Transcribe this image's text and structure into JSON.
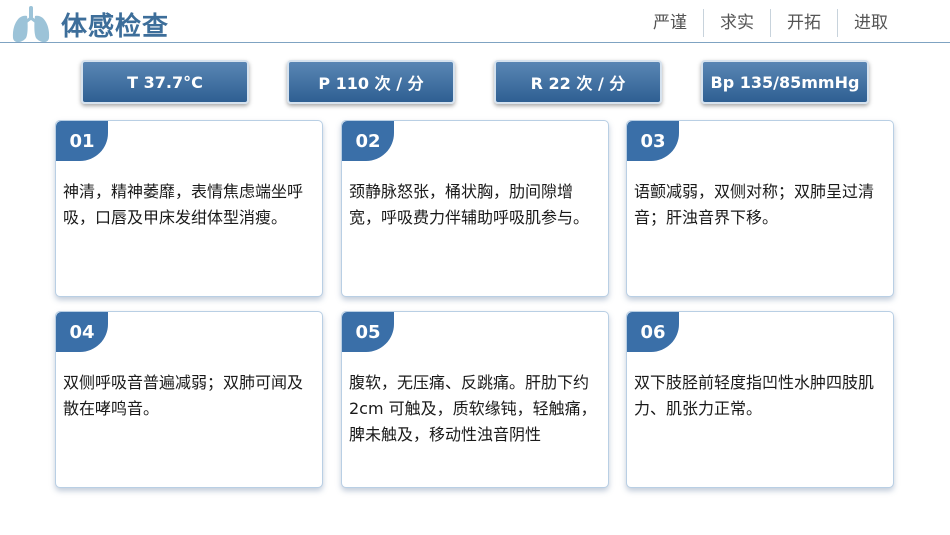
{
  "header": {
    "title": "体感检查",
    "nav": [
      "严谨",
      "求实",
      "开拓",
      "进取"
    ]
  },
  "vitals": [
    "T 37.7°C",
    "P 110 次 / 分",
    "R 22 次 / 分",
    "Bp 135/85mmHg"
  ],
  "cards": [
    {
      "num": "01",
      "text": "神清，精神萎靡，表情焦虑端坐呼吸，口唇及甲床发绀体型消瘦。"
    },
    {
      "num": "02",
      "text": "颈静脉怒张，桶状胸，肋间隙增宽，呼吸费力伴辅助呼吸肌参与。"
    },
    {
      "num": "03",
      "text": "语颤减弱，双侧对称；双肺呈过清音；肝浊音界下移。"
    },
    {
      "num": "04",
      "text": "双侧呼吸音普遍减弱；双肺可闻及散在哮鸣音。"
    },
    {
      "num": "05",
      "text": "腹软，无压痛、反跳痛。肝肋下约 2cm 可触及，质软缘钝，轻触痛，脾未触及，移动性浊音阴性"
    },
    {
      "num": "06",
      "text": "双下肢胫前轻度指凹性水肿四肢肌力、肌张力正常。"
    }
  ],
  "colors": {
    "accent": "#3a6fa8",
    "title": "#3d6e9a",
    "lungs": "#9cc3d8"
  },
  "icons": {
    "logo": "lungs-icon"
  }
}
